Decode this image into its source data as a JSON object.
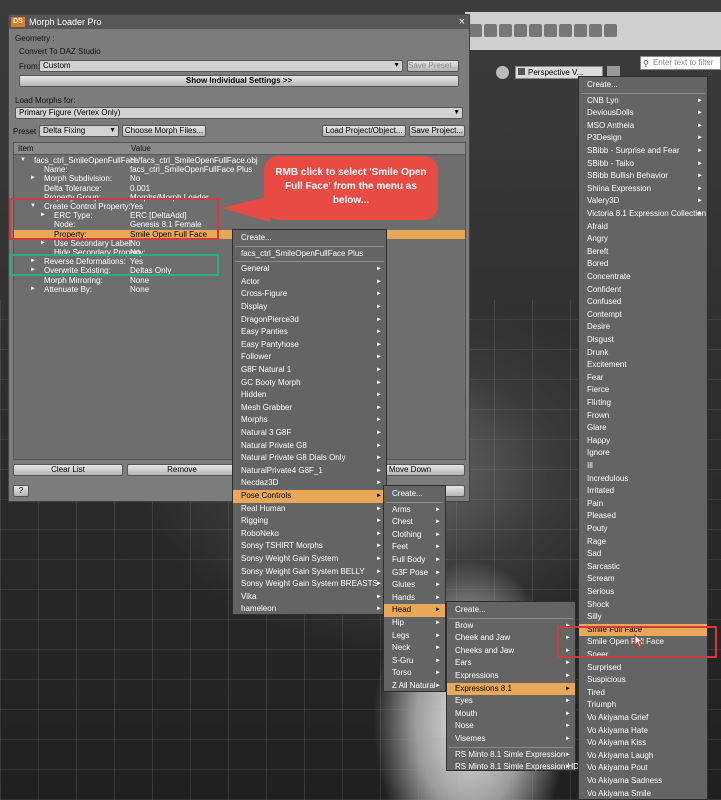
{
  "toolbar": {
    "search_placeholder": "Enter text to filter",
    "perspective_view": "Perspective V..."
  },
  "dialog": {
    "title": "Morph Loader Pro",
    "ds_logo": "DS",
    "close": "×",
    "geometry_label": "Geometry :",
    "convert_label": "Convert To DAZ Studio",
    "from_label": "From:",
    "from_value": "Custom",
    "save_preset": "Save Preset...",
    "show_settings": "Show Individual Settings >>",
    "load_morphs_label": "Load Morphs for:",
    "load_morphs_value": "Primary Figure (Vertex Only)",
    "preset_label": "Preset",
    "preset_value": "Delta Fixing",
    "choose_files": "Choose Morph Files...",
    "load_project": "Load Project/Object...",
    "save_project": "Save Project...",
    "col_item": "Item",
    "col_value": "Value",
    "tree": [
      {
        "name": "facs_ctrl_SmileOpenFullFace",
        "value": "H:/facs_ctrl_SmileOpenFullFace.obj",
        "indent": 0,
        "twist": "▼"
      },
      {
        "name": "Name:",
        "value": "facs_ctrl_SmileOpenFullFace Plus",
        "indent": 1,
        "twist": ""
      },
      {
        "name": "Morph Subdivision:",
        "value": "No",
        "indent": 1,
        "twist": "►"
      },
      {
        "name": "Delta Tolerance:",
        "value": "0.001",
        "indent": 1,
        "twist": ""
      },
      {
        "name": "Property Group:",
        "value": "Morphs/Morph Loader",
        "indent": 1,
        "twist": ""
      },
      {
        "name": "Create Control Property:",
        "value": "Yes",
        "indent": 1,
        "twist": "▼"
      },
      {
        "name": "ERC Type:",
        "value": "ERC [DeltaAdd]",
        "indent": 2,
        "twist": "►"
      },
      {
        "name": "Node:",
        "value": "Genesis 8.1 Female",
        "indent": 2,
        "twist": ""
      },
      {
        "name": "Property:",
        "value": "Smile Open Full Face",
        "indent": 2,
        "twist": "",
        "highlight": true
      },
      {
        "name": "Use Secondary Label:",
        "value": "No",
        "indent": 2,
        "twist": "►"
      },
      {
        "name": "Hide Secondary Property:",
        "value": "No",
        "indent": 2,
        "twist": ""
      },
      {
        "name": "Reverse Deformations:",
        "value": "Yes",
        "indent": 1,
        "twist": "►"
      },
      {
        "name": "Overwrite Existing:",
        "value": "Deltas Only",
        "indent": 1,
        "twist": "►"
      },
      {
        "name": "Morph Mirroring:",
        "value": "None",
        "indent": 1,
        "twist": ""
      },
      {
        "name": "Attenuate By:",
        "value": "None",
        "indent": 1,
        "twist": "►"
      }
    ],
    "clear_list": "Clear List",
    "remove": "Remove",
    "move_down": "Move Down",
    "help": "?"
  },
  "callout": "RMB click to select 'Smile Open Full Face' from the menu as below...",
  "menu1": {
    "items": [
      {
        "label": "Create...",
        "sub": false
      },
      {
        "label": "facs_ctrl_SmileOpenFullFace Plus",
        "sub": false
      },
      {
        "label": "General",
        "sub": true
      },
      {
        "label": "Actor",
        "sub": true
      },
      {
        "label": "Cross-Figure",
        "sub": true
      },
      {
        "label": "Display",
        "sub": true
      },
      {
        "label": "DragonPierce3d",
        "sub": true
      },
      {
        "label": "Easy Panties",
        "sub": true
      },
      {
        "label": "Easy Pantyhose",
        "sub": true
      },
      {
        "label": "Follower",
        "sub": true
      },
      {
        "label": "G8F Natural 1",
        "sub": true
      },
      {
        "label": "GC Booty Morph",
        "sub": true
      },
      {
        "label": "Hidden",
        "sub": true
      },
      {
        "label": "Mesh Grabber",
        "sub": true
      },
      {
        "label": "Morphs",
        "sub": true
      },
      {
        "label": "Natural 3 G8F",
        "sub": true
      },
      {
        "label": "Natural Private G8",
        "sub": true
      },
      {
        "label": "Natural Private G8 Dials Only",
        "sub": true
      },
      {
        "label": "NaturalPrivate4 G8F_1",
        "sub": true
      },
      {
        "label": "Necdaz3D",
        "sub": true
      },
      {
        "label": "Pose Controls",
        "sub": true
      },
      {
        "label": "Real Human",
        "sub": true
      },
      {
        "label": "Rigging",
        "sub": true
      },
      {
        "label": "RoboNeko",
        "sub": true
      },
      {
        "label": "Sonsy TSHIRT Morphs",
        "sub": true
      },
      {
        "label": "Sonsy Weight Gain System",
        "sub": true
      },
      {
        "label": "Sonsy Weight Gain System BELLY",
        "sub": true
      },
      {
        "label": "Sonsy Weight Gain System BREASTS",
        "sub": true
      },
      {
        "label": "Vika",
        "sub": true
      },
      {
        "label": "hameleon",
        "sub": true
      }
    ]
  },
  "menu2": {
    "items": [
      {
        "label": "Create...",
        "sub": false
      },
      {
        "label": "Arms",
        "sub": true
      },
      {
        "label": "Chest",
        "sub": true
      },
      {
        "label": "Clothing",
        "sub": true
      },
      {
        "label": "Feet",
        "sub": true
      },
      {
        "label": "Full Body",
        "sub": true
      },
      {
        "label": "G3F Pose",
        "sub": true
      },
      {
        "label": "Glutes",
        "sub": true
      },
      {
        "label": "Hands",
        "sub": true
      },
      {
        "label": "Head",
        "sub": true
      },
      {
        "label": "Hip",
        "sub": true
      },
      {
        "label": "Legs",
        "sub": true
      },
      {
        "label": "Neck",
        "sub": true
      },
      {
        "label": "S-Gru",
        "sub": true
      },
      {
        "label": "Torso",
        "sub": true
      },
      {
        "label": "Z All Natural",
        "sub": true
      }
    ]
  },
  "menu3": {
    "items": [
      {
        "label": "Create...",
        "sub": false
      },
      {
        "label": "Brow",
        "sub": true
      },
      {
        "label": "Cheek and Jaw",
        "sub": true
      },
      {
        "label": "Cheeks and Jaw",
        "sub": true
      },
      {
        "label": "Ears",
        "sub": true
      },
      {
        "label": "Expressions",
        "sub": true
      },
      {
        "label": "Expressions 8.1",
        "sub": true
      },
      {
        "label": "Eyes",
        "sub": true
      },
      {
        "label": "Mouth",
        "sub": true
      },
      {
        "label": "Nose",
        "sub": true
      },
      {
        "label": "Visemes",
        "sub": true
      },
      {
        "label": "RS Minto 8.1 Simle Expression",
        "sub": true
      },
      {
        "label": "RS Minto 8.1 Simle Expression HD",
        "sub": true
      }
    ]
  },
  "menu4": {
    "items": [
      {
        "label": "Create...",
        "sub": false
      },
      {
        "label": "CNB Lyn",
        "sub": true
      },
      {
        "label": "DeviousDolls",
        "sub": true
      },
      {
        "label": "MSO Antheia",
        "sub": true
      },
      {
        "label": "P3Design",
        "sub": true
      },
      {
        "label": "SBibb - Surprise and Fear",
        "sub": true
      },
      {
        "label": "SBibb - Taiko",
        "sub": true
      },
      {
        "label": "SBibb Bullish Behavior",
        "sub": true
      },
      {
        "label": "Shiina Expression",
        "sub": true
      },
      {
        "label": "Valery3D",
        "sub": true
      },
      {
        "label": "Victoria 8.1 Expression Collection",
        "sub": true
      },
      {
        "label": "Afraid",
        "sub": false
      },
      {
        "label": "Angry",
        "sub": false
      },
      {
        "label": "Bereft",
        "sub": false
      },
      {
        "label": "Bored",
        "sub": false
      },
      {
        "label": "Concentrate",
        "sub": false
      },
      {
        "label": "Confident",
        "sub": false
      },
      {
        "label": "Confused",
        "sub": false
      },
      {
        "label": "Contempt",
        "sub": false
      },
      {
        "label": "Desire",
        "sub": false
      },
      {
        "label": "Disgust",
        "sub": false
      },
      {
        "label": "Drunk",
        "sub": false
      },
      {
        "label": "Excitement",
        "sub": false
      },
      {
        "label": "Fear",
        "sub": false
      },
      {
        "label": "Fierce",
        "sub": false
      },
      {
        "label": "Flirting",
        "sub": false
      },
      {
        "label": "Frown",
        "sub": false
      },
      {
        "label": "Glare",
        "sub": false
      },
      {
        "label": "Happy",
        "sub": false
      },
      {
        "label": "Ignore",
        "sub": false
      },
      {
        "label": "Ill",
        "sub": false
      },
      {
        "label": "Incredulous",
        "sub": false
      },
      {
        "label": "Irritated",
        "sub": false
      },
      {
        "label": "Pain",
        "sub": false
      },
      {
        "label": "Pleased",
        "sub": false
      },
      {
        "label": "Pouty",
        "sub": false
      },
      {
        "label": "Rage",
        "sub": false
      },
      {
        "label": "Sad",
        "sub": false
      },
      {
        "label": "Sarcastic",
        "sub": false
      },
      {
        "label": "Scream",
        "sub": false
      },
      {
        "label": "Serious",
        "sub": false
      },
      {
        "label": "Shock",
        "sub": false
      },
      {
        "label": "Silly",
        "sub": false
      },
      {
        "label": "Smile Full Face",
        "sub": false
      },
      {
        "label": "Smile Open Full Face",
        "sub": false
      },
      {
        "label": "Sneer",
        "sub": false
      },
      {
        "label": "Surprised",
        "sub": false
      },
      {
        "label": "Suspicious",
        "sub": false
      },
      {
        "label": "Tired",
        "sub": false
      },
      {
        "label": "Triumph",
        "sub": false
      },
      {
        "label": "Vo Akiyama Grief",
        "sub": false
      },
      {
        "label": "Vo Akiyama Hate",
        "sub": false
      },
      {
        "label": "Vo Akiyama Kiss",
        "sub": false
      },
      {
        "label": "Vo Akiyama Laugh",
        "sub": false
      },
      {
        "label": "Vo Akiyama Pout",
        "sub": false
      },
      {
        "label": "Vo Akiyama Sadness",
        "sub": false
      },
      {
        "label": "Vo Akiyama Smile",
        "sub": false
      }
    ]
  },
  "colors": {
    "highlight": "#e9a857",
    "menu_bg": "#646464",
    "annotation_red": "#d23b3b",
    "annotation_green": "#2eaa87",
    "callout": "#e84b44"
  }
}
